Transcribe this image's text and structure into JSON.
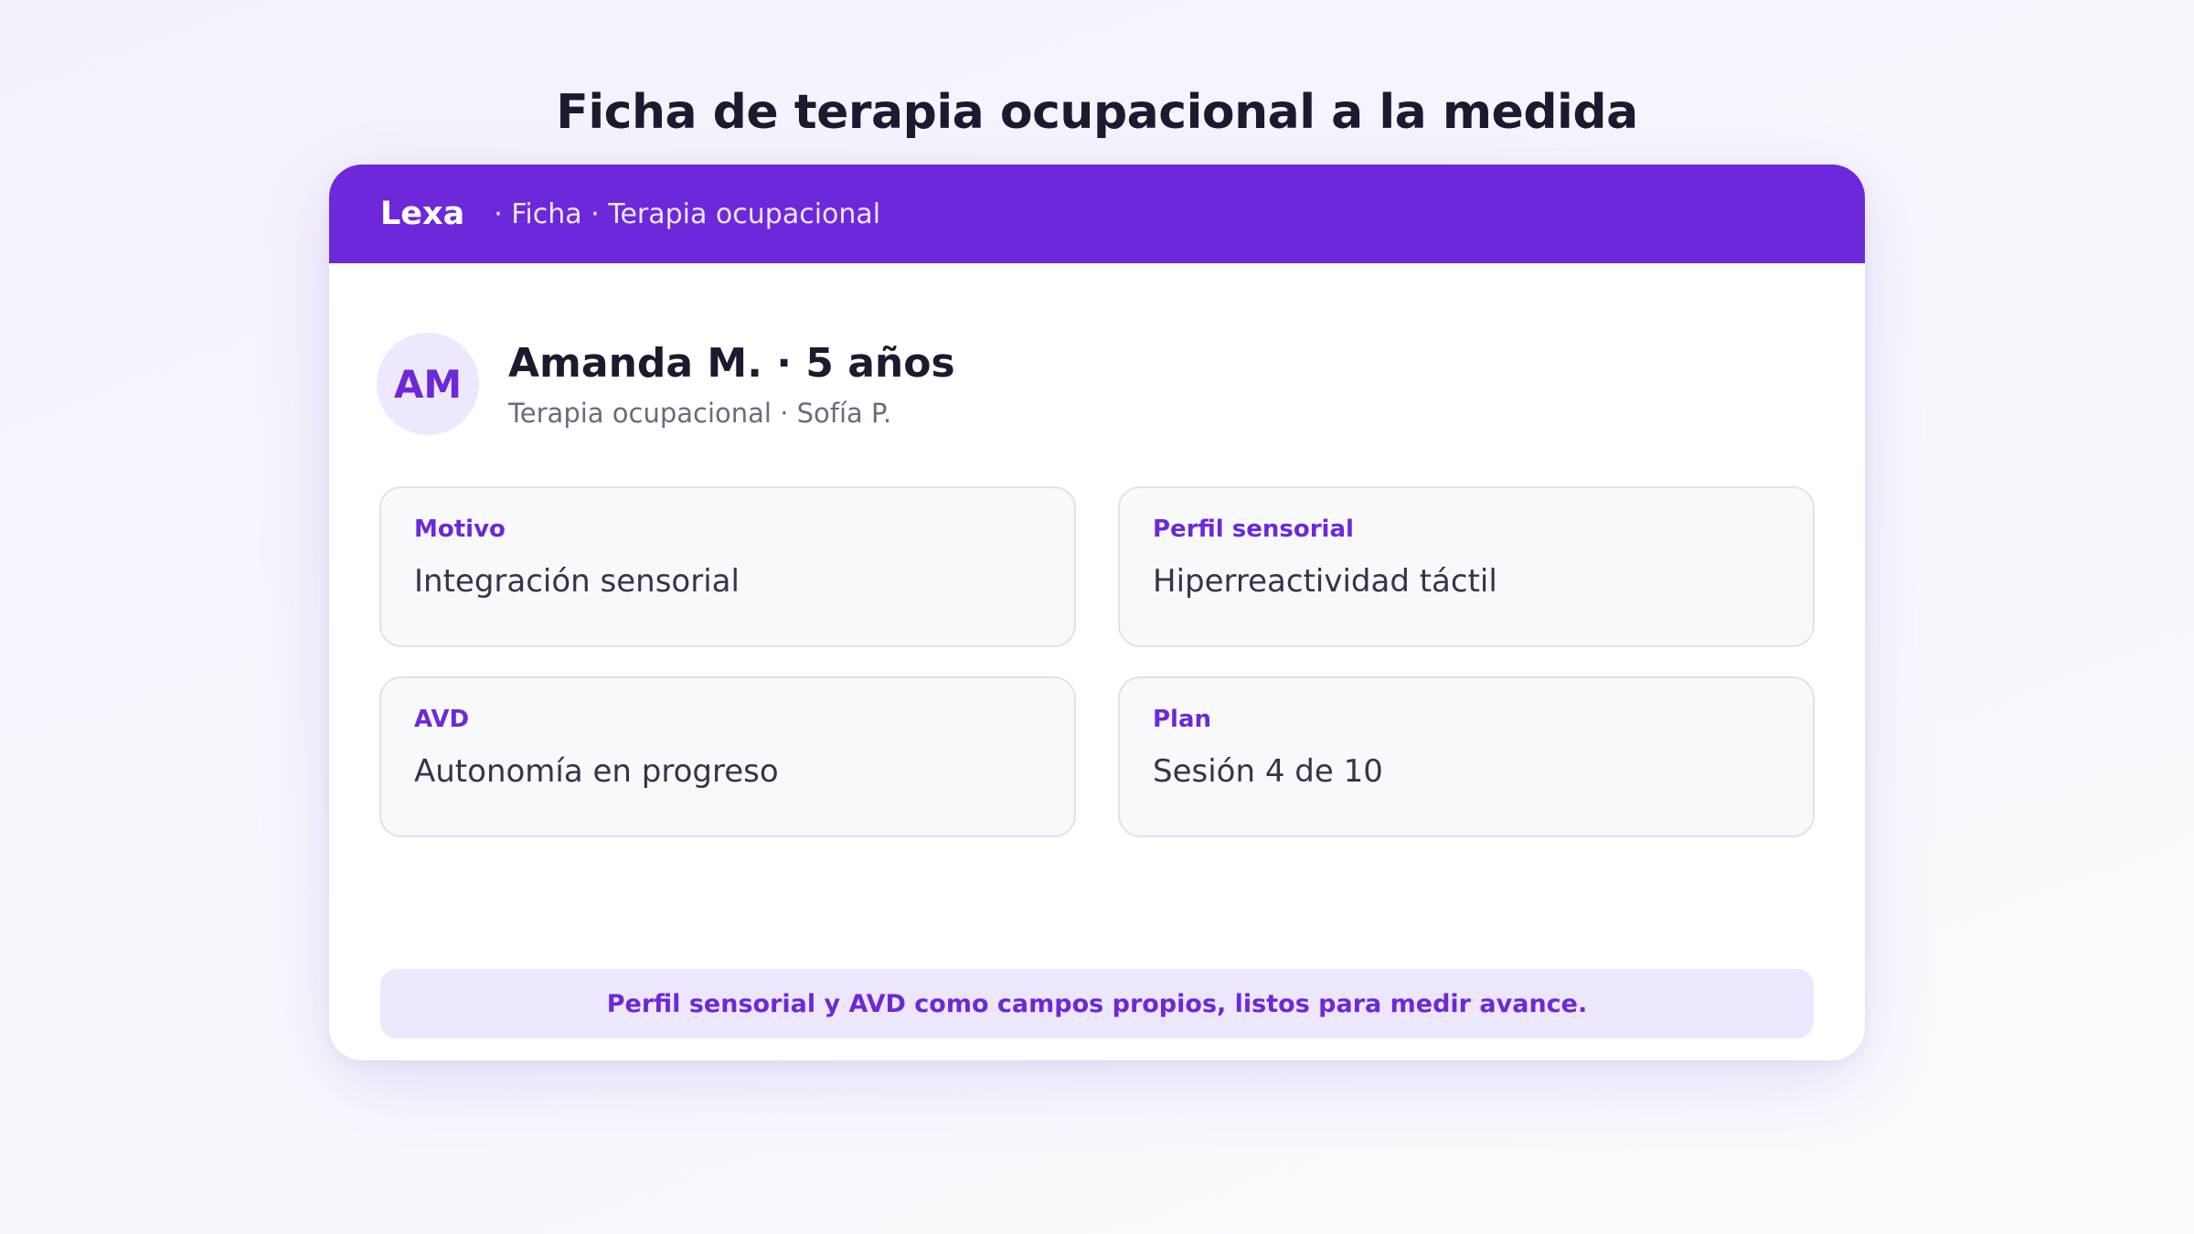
{
  "page": {
    "title": "Ficha de terapia ocupacional a la medida"
  },
  "header": {
    "brand": "Lexa",
    "breadcrumb": "· Ficha · Terapia ocupacional"
  },
  "patient": {
    "initials": "AM",
    "name": "Amanda M. · 5 años",
    "subtitle": "Terapia ocupacional · Sofía P."
  },
  "fields": [
    {
      "label": "Motivo",
      "value": "Integración sensorial"
    },
    {
      "label": "Perfil sensorial",
      "value": "Hiperreactividad táctil"
    },
    {
      "label": "AVD",
      "value": "Autonomía en progreso"
    },
    {
      "label": "Plan",
      "value": "Sesión 4 de 10"
    }
  ],
  "footer": {
    "note": "Perfil sensorial y AVD como campos propios, listos para medir avance."
  },
  "colors": {
    "accent": "#6d28d9",
    "accent_light": "#ece7fc",
    "card_bg": "#ffffff",
    "field_bg": "#f8f9fb"
  }
}
